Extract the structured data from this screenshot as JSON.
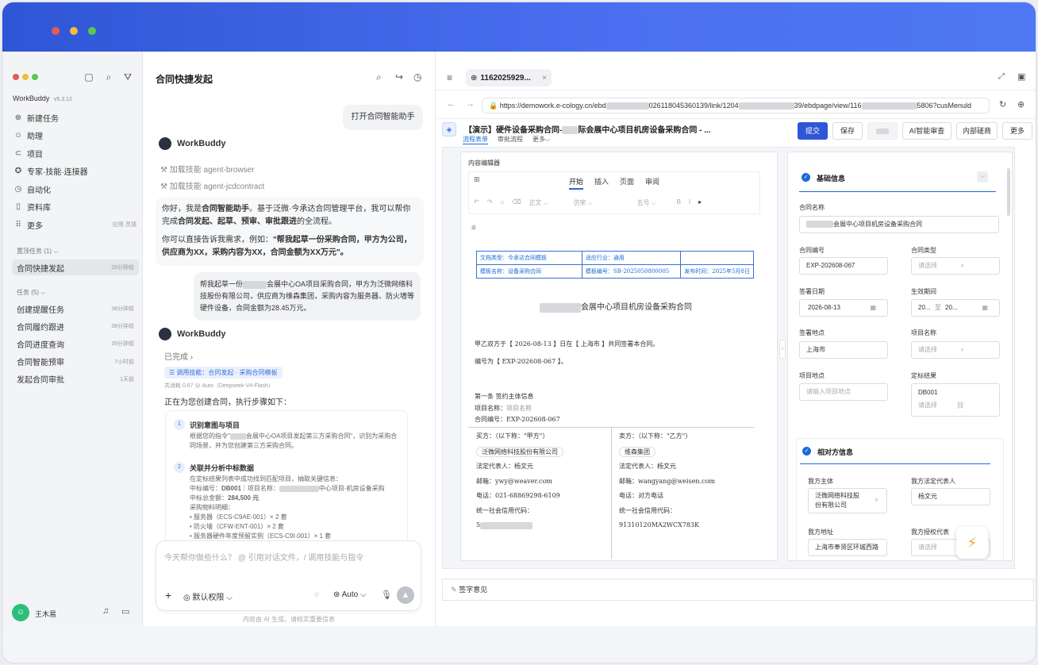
{
  "sidebar": {
    "app_name": "WorkBuddy",
    "version": "v5.3.12",
    "nav": [
      {
        "icon": "plus-circle-icon",
        "label": "新建任务"
      },
      {
        "icon": "robot-icon",
        "label": "助理"
      },
      {
        "icon": "folder-icon",
        "label": "项目"
      },
      {
        "icon": "skills-icon",
        "label": "专家·技能·连接器"
      },
      {
        "icon": "clock-icon",
        "label": "自动化"
      },
      {
        "icon": "book-icon",
        "label": "资料库"
      },
      {
        "icon": "grid-icon",
        "label": "更多",
        "sub": "应用·灵感"
      }
    ],
    "pinned_header": "置顶任务 (1)",
    "pinned": [
      {
        "title": "合同快捷发起",
        "time": "28分钟前"
      }
    ],
    "tasks_header": "任务 (5)",
    "tasks": [
      {
        "title": "创建提醒任务",
        "time": "38分钟前"
      },
      {
        "title": "合同履约跟进",
        "time": "38分钟前"
      },
      {
        "title": "合同进度查询",
        "time": "39分钟前"
      },
      {
        "title": "合同智能预审",
        "time": "7小时前"
      },
      {
        "title": "发起合同审批",
        "time": "1天前"
      }
    ],
    "user": "王木易"
  },
  "chat": {
    "title": "合同快捷发起",
    "user_msg_1": "打开合同智能助手",
    "bot_name": "WorkBuddy",
    "skill_1": "加载技能 agent-browser",
    "skill_2": "加载技能 agent-jcdcontract",
    "intro_p1a": "你好，我是",
    "intro_p1b": "合同智能助手",
    "intro_p1c": "。基于泛微·今承达合同管理平台，我可以帮你完成",
    "intro_p1d": "合同发起、起草、预审、审批跟进",
    "intro_p1e": "的全流程。",
    "intro_p2a": "你可以直接告诉我需求，例如：",
    "intro_p2b": "\"帮我起草一份采购合同，甲方为公司，供应商为XX，采购内容为XX，合同金额为XX万元\"。",
    "user_msg_2a": "帮我起草一份",
    "user_msg_2b": "会展中心OA项目采购合同，甲方为泛微网络科技股份有限公司，供应商为维森集团，采购内容为服务器、防火墙等硬件设备，合同金额为28.45万元。",
    "done_label": "已完成",
    "skill_tag": "调用技能：合同发起 · 采购合同模板",
    "usage": "共消耗 0.67 分 Auto（Deepseek-V4-Flash）",
    "creating": "正在为您创建合同，执行步骤如下：",
    "step1_title": "识别意图与项目",
    "step1_a": "根据您的指令\"",
    "step1_b": "会展中心OA项目发起第三方采购合同\"，识别为采购合同场景，并为您创建第三方采购合同。",
    "step2_title": "关联并分析中标数据",
    "step2_l1": "在定标结果列表中成功找到匹配项目，抽取关键信息：",
    "step2_l2a": "中标编号：",
    "step2_l2b": "DB001",
    "step2_l2c": "｜项目名称：",
    "step2_l2d": "中心项目-机房设备采购",
    "step2_l3a": "中标总金额：",
    "step2_l3b": "284,500 元",
    "step2_l4": "采购物料明细：",
    "step2_l5": "• 服务器（ECS-C9AE-001）× 2 套",
    "step2_l6": "• 防火墙（CFW-ENT-001）× 2 套",
    "step2_l7": "• 服务器硬件年度预留实例（ECS-C9I-001）× 1 套",
    "input_placeholder": "今天帮你做些什么？ @ 引用对话文件，/ 调用技能与指令",
    "permission": "默认权限",
    "model": "Auto",
    "disclaimer": "内容由 AI 生成，请核实重要信息"
  },
  "browser": {
    "tab_title": "1162025929...",
    "url_a": "https://demowork.e-cology.cn/ebd",
    "url_b": "026118045360139/link/1204",
    "url_c": "39/ebdpage/view/116",
    "url_d": "5806?cusMenuld",
    "doc_title": "【演示】硬件设备采购合同-",
    "doc_title_b": "际会展中心项目机房设备采购合同 - ...",
    "tabs": [
      "流程表单",
      "审批流程",
      "更多"
    ],
    "buttons": [
      "提交",
      "保存",
      "AI智能审查",
      "内部磋商",
      "更多"
    ],
    "editor_title": "内容编辑器",
    "editor_tabs": [
      "开始",
      "插入",
      "页面",
      "审阅"
    ],
    "fmt": [
      "正文",
      "仿宋",
      "五号"
    ],
    "table": {
      "r1c1": "文档类型：今承达合同模板",
      "r1c2": "适应行业：通用",
      "r2c1": "模板名称：设备采购合同",
      "r2c2": "模板编号：SB-2025050800005",
      "r2c3": "发布时间：2025年5月8日"
    },
    "contract_title": "会展中心项目机房设备采购合同",
    "line1": "甲乙双方于【 2026-08-13 】日在【 上海市 】共同签署本合同。",
    "line2": "编号为【 EXP-202608-067 】。",
    "art1": "第一条  签约主体信息",
    "proj_label": "项目名称：",
    "proj_val": "项目名称",
    "code_label": "合同编号：",
    "code_val": "EXP-202608-067",
    "buyer_h": "买方：（以下称：\"甲方\"）",
    "seller_h": "卖方：（以下称：\"乙方\"）",
    "buyer": [
      "泛微网络科技股份有限公司",
      "法定代表人：杨文元",
      "邮箱：ywy@weaver.com",
      "电话：021-68869298-6109",
      "统一社会信用代码："
    ],
    "seller": [
      "维森集团",
      "法定代表人：杨文元",
      "邮箱：wangyang@weisen.com",
      "电话：对方电话",
      "统一社会信用代码："
    ],
    "buyer_credit": "5",
    "seller_credit": "91310120MA2WCX783K",
    "form": {
      "basic_title": "基础信息",
      "name_l": "合同名称",
      "name_v": "会展中心项目机房设备采购合同",
      "code_l": "合同编号",
      "code_v": "EXP-202608-067",
      "type_l": "合同类型",
      "type_ph": "请选择",
      "date_l": "签署日期",
      "date_v": "2026-08-13",
      "eff_l": "生效期间",
      "eff_a": "20...",
      "eff_to": "至",
      "eff_b": "20...",
      "place_l": "签署地点",
      "place_v": "上海市",
      "projname_l": "项目名称",
      "projname_ph": "请选择",
      "projloc_l": "项目地点",
      "projloc_ph": "请输入项目地点",
      "bid_l": "定标结果",
      "bid_v": "DB001",
      "bid_ph": "请选择",
      "party_title": "相对方信息",
      "our_l": "我方主体",
      "our_v": "泛微网络科技股份有限公司",
      "legal_l": "我方法定代表人",
      "legal_v": "杨文元",
      "addr_l": "我方地址",
      "addr_v": "上海市奉贤区环城西路",
      "agent_l": "我方授权代表",
      "agent_ph": "请选择"
    },
    "comment": "签字意见"
  },
  "colors": {
    "brand": "#2f56d6",
    "accent": "#1f5fd0",
    "link": "#1a6bd8"
  }
}
